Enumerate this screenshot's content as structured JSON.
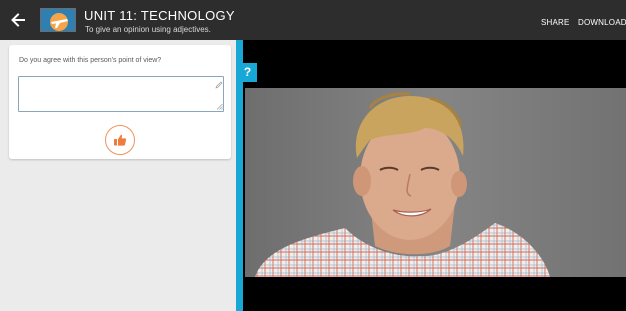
{
  "header": {
    "title": "UNIT 11: TECHNOLOGY",
    "subtitle": "To give an opinion using adjectives.",
    "share_label": "SHARE",
    "download_label": "DOWNLOAD LE",
    "back_icon": "arrow-left-icon",
    "thumbnail_icon": "airplane-thumbnail-icon"
  },
  "activity": {
    "question": "Do you agree with this person's point of view?",
    "answer_value": "",
    "like_icon": "thumbs-up-icon"
  },
  "video": {
    "help_label": "?"
  },
  "colors": {
    "topbar": "#2d2d2d",
    "accent_blue": "#17a8d6",
    "like_orange": "#f07b3f",
    "panel_bg": "#ebebeb"
  }
}
